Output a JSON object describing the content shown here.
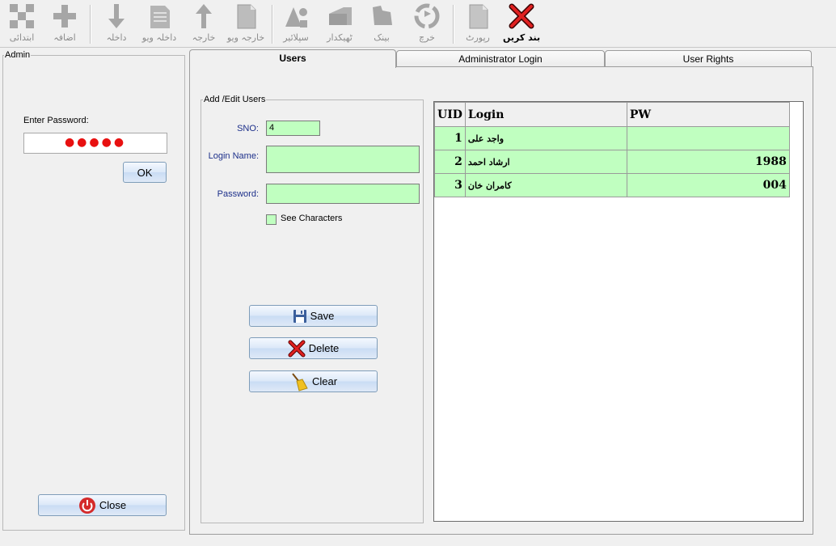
{
  "toolbar": {
    "items": [
      {
        "label": "ابتدائی",
        "icon": "grid-icon"
      },
      {
        "label": "اضافہ",
        "icon": "plus-icon"
      },
      {
        "label": "داخلہ",
        "icon": "arrow-down-icon"
      },
      {
        "label": "داخلہ ویو",
        "icon": "notepad-icon"
      },
      {
        "label": "خارجہ",
        "icon": "arrow-up-icon"
      },
      {
        "label": "خارجہ ویو",
        "icon": "document-icon"
      },
      {
        "label": "سپلائیر",
        "icon": "shapes-icon"
      },
      {
        "label": "ٹھیکدار",
        "icon": "folder-icon"
      },
      {
        "label": "بینک",
        "icon": "bank-icon"
      },
      {
        "label": "خرچ",
        "icon": "recycle-icon"
      },
      {
        "label": "رپورٹ",
        "icon": "report-icon"
      },
      {
        "label": "بند کریں",
        "icon": "close-x-icon"
      }
    ]
  },
  "admin": {
    "title": "Admin",
    "password_label": "Enter Password:",
    "password_mask": "●●●●●",
    "ok_label": "OK",
    "close_label": "Close"
  },
  "tabs": [
    "Users",
    "Administrator Login",
    "User Rights"
  ],
  "edit": {
    "title": "Add /Edit Users",
    "sno_label": "SNO:",
    "sno_value": "4",
    "login_label": "Login Name:",
    "password_label": "Password:",
    "see_chars_label": "See Characters",
    "save_label": "Save",
    "delete_label": "Delete",
    "clear_label": "Clear"
  },
  "grid": {
    "columns": [
      "UID",
      "Login",
      "PW"
    ],
    "rows": [
      {
        "uid": "1",
        "login": "واجد علی",
        "pw": ""
      },
      {
        "uid": "2",
        "login": "ارشاد احمد",
        "pw": "1988"
      },
      {
        "uid": "3",
        "login": "کامران خان",
        "pw": "004"
      }
    ]
  },
  "colors": {
    "accent_green": "#c0ffc0",
    "label_blue": "#1c2f8a",
    "close_red": "#e81010"
  }
}
